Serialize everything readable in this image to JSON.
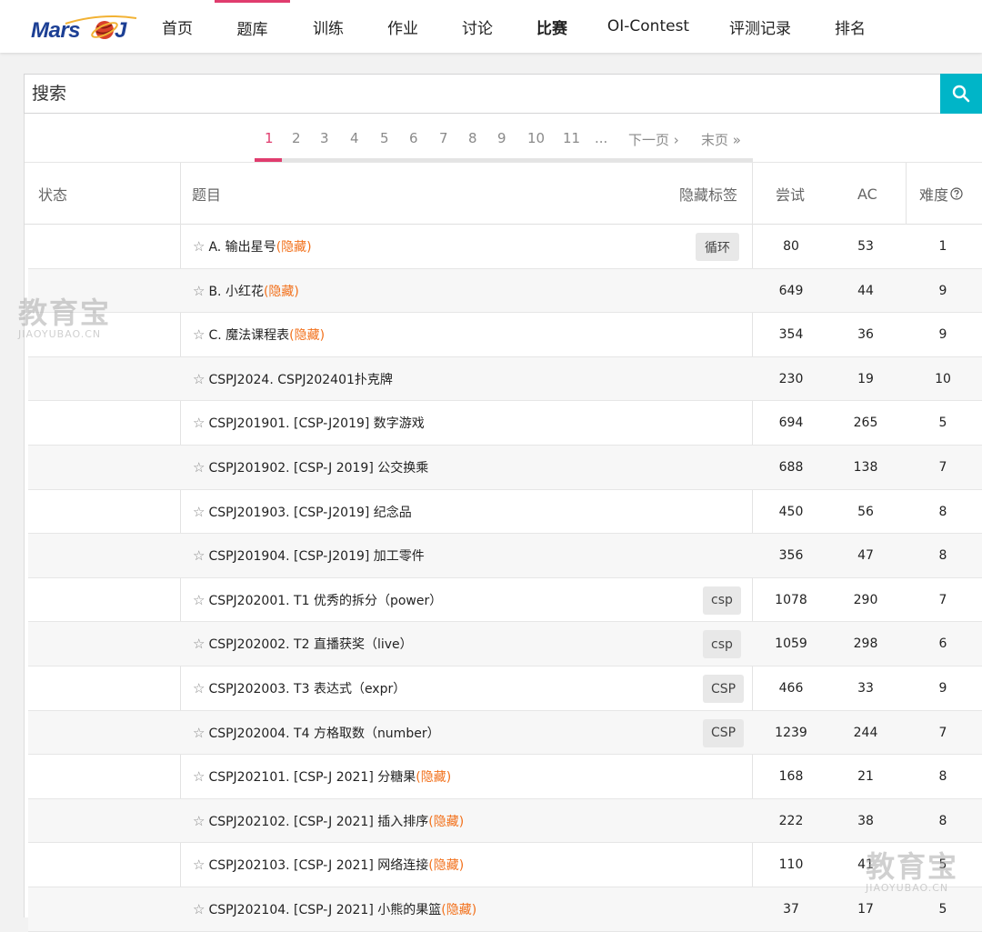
{
  "logo": {
    "text": "Mars",
    "suffix": "J"
  },
  "nav": [
    {
      "label": "首页",
      "key": "home"
    },
    {
      "label": "题库",
      "key": "problems"
    },
    {
      "label": "训练",
      "key": "training"
    },
    {
      "label": "作业",
      "key": "homework"
    },
    {
      "label": "讨论",
      "key": "discussion"
    },
    {
      "label": "比赛",
      "key": "contest"
    },
    {
      "label": "OI-Contest",
      "key": "oi-contest"
    },
    {
      "label": "评测记录",
      "key": "records"
    },
    {
      "label": "排名",
      "key": "ranking"
    }
  ],
  "search": {
    "placeholder": "搜索",
    "value": ""
  },
  "pagination": {
    "pages": [
      "1",
      "2",
      "3",
      "4",
      "5",
      "6",
      "7",
      "8",
      "9",
      "10",
      "11",
      "..."
    ],
    "next": "下一页 ›",
    "last": "末页 »",
    "current": "1"
  },
  "table": {
    "headers": {
      "status": "状态",
      "title": "题目",
      "hidden_tags": "隐藏标签",
      "attempts": "尝试",
      "ac": "AC",
      "difficulty": "难度"
    },
    "hidden_marker": "(隐藏)",
    "rows": [
      {
        "title": "A. 输出星号",
        "hidden": true,
        "tag": "循环",
        "attempts": "80",
        "ac": "53",
        "difficulty": "1"
      },
      {
        "title": "B. 小红花",
        "hidden": true,
        "tag": "",
        "attempts": "649",
        "ac": "44",
        "difficulty": "9"
      },
      {
        "title": "C. 魔法课程表",
        "hidden": true,
        "tag": "",
        "attempts": "354",
        "ac": "36",
        "difficulty": "9"
      },
      {
        "title": "CSPJ2024. CSPJ202401扑克牌",
        "hidden": false,
        "tag": "",
        "attempts": "230",
        "ac": "19",
        "difficulty": "10"
      },
      {
        "title": "CSPJ201901. [CSP-J2019] 数字游戏",
        "hidden": false,
        "tag": "",
        "attempts": "694",
        "ac": "265",
        "difficulty": "5"
      },
      {
        "title": "CSPJ201902. [CSP-J 2019] 公交换乘",
        "hidden": false,
        "tag": "",
        "attempts": "688",
        "ac": "138",
        "difficulty": "7"
      },
      {
        "title": "CSPJ201903. [CSP-J2019] 纪念品",
        "hidden": false,
        "tag": "",
        "attempts": "450",
        "ac": "56",
        "difficulty": "8"
      },
      {
        "title": "CSPJ201904. [CSP-J2019] 加工零件",
        "hidden": false,
        "tag": "",
        "attempts": "356",
        "ac": "47",
        "difficulty": "8"
      },
      {
        "title": "CSPJ202001. T1 优秀的拆分（power）",
        "hidden": false,
        "tag": "csp",
        "attempts": "1078",
        "ac": "290",
        "difficulty": "7"
      },
      {
        "title": "CSPJ202002. T2 直播获奖（live）",
        "hidden": false,
        "tag": "csp",
        "attempts": "1059",
        "ac": "298",
        "difficulty": "6"
      },
      {
        "title": "CSPJ202003. T3 表达式（expr）",
        "hidden": false,
        "tag": "CSP",
        "attempts": "466",
        "ac": "33",
        "difficulty": "9"
      },
      {
        "title": "CSPJ202004. T4 方格取数（number）",
        "hidden": false,
        "tag": "CSP",
        "attempts": "1239",
        "ac": "244",
        "difficulty": "7"
      },
      {
        "title": "CSPJ202101. [CSP-J 2021] 分糖果",
        "hidden": true,
        "tag": "",
        "attempts": "168",
        "ac": "21",
        "difficulty": "8"
      },
      {
        "title": "CSPJ202102. [CSP-J 2021] 插入排序",
        "hidden": true,
        "tag": "",
        "attempts": "222",
        "ac": "38",
        "difficulty": "8"
      },
      {
        "title": "CSPJ202103. [CSP-J 2021] 网络连接",
        "hidden": true,
        "tag": "",
        "attempts": "110",
        "ac": "41",
        "difficulty": "5"
      },
      {
        "title": "CSPJ202104. [CSP-J 2021] 小熊的果篮",
        "hidden": true,
        "tag": "",
        "attempts": "37",
        "ac": "17",
        "difficulty": "5"
      }
    ]
  },
  "watermark": {
    "big": "教育宝",
    "small": "JIAOYUBAO.CN"
  },
  "colors": {
    "accent": "#e03c6e",
    "search_button": "#00b5c8",
    "hidden": "#f2711c",
    "logo": "#1c3f94"
  }
}
